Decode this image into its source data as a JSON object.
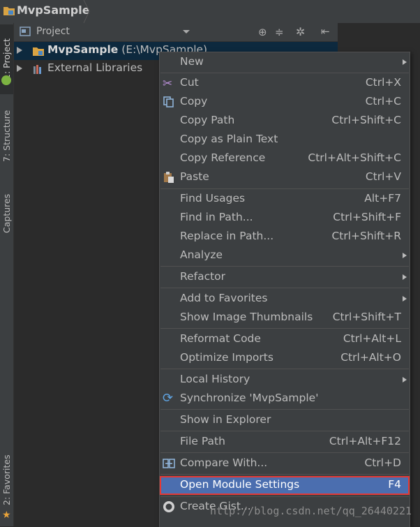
{
  "breadcrumb": {
    "title": "MvpSample"
  },
  "tool_strip": {
    "tabs": [
      {
        "label": "1: Project"
      },
      {
        "label": "7: Structure"
      },
      {
        "label": "Captures"
      },
      {
        "label": "2: Favorites"
      }
    ]
  },
  "project_panel": {
    "view_label": "Project",
    "tree": [
      {
        "name": "MvpSample",
        "path": "(E:\\MvpSample)"
      },
      {
        "name": "External Libraries"
      }
    ]
  },
  "context_menu": {
    "items": [
      {
        "label": "New",
        "shortcut": "",
        "submenu": true
      },
      {
        "label": "Cut",
        "shortcut": "Ctrl+X",
        "icon": "scissors-icon"
      },
      {
        "label": "Copy",
        "shortcut": "Ctrl+C",
        "icon": "copy-icon"
      },
      {
        "label": "Copy Path",
        "shortcut": "Ctrl+Shift+C"
      },
      {
        "label": "Copy as Plain Text",
        "shortcut": ""
      },
      {
        "label": "Copy Reference",
        "shortcut": "Ctrl+Alt+Shift+C"
      },
      {
        "label": "Paste",
        "shortcut": "Ctrl+V",
        "icon": "paste-icon"
      },
      {
        "label": "Find Usages",
        "shortcut": "Alt+F7"
      },
      {
        "label": "Find in Path...",
        "shortcut": "Ctrl+Shift+F"
      },
      {
        "label": "Replace in Path...",
        "shortcut": "Ctrl+Shift+R"
      },
      {
        "label": "Analyze",
        "shortcut": "",
        "submenu": true
      },
      {
        "label": "Refactor",
        "shortcut": "",
        "submenu": true
      },
      {
        "label": "Add to Favorites",
        "shortcut": "",
        "submenu": true
      },
      {
        "label": "Show Image Thumbnails",
        "shortcut": "Ctrl+Shift+T"
      },
      {
        "label": "Reformat Code",
        "shortcut": "Ctrl+Alt+L"
      },
      {
        "label": "Optimize Imports",
        "shortcut": "Ctrl+Alt+O"
      },
      {
        "label": "Local History",
        "shortcut": "",
        "submenu": true
      },
      {
        "label": "Synchronize 'MvpSample'",
        "shortcut": "",
        "icon": "sync-icon"
      },
      {
        "label": "Show in Explorer",
        "shortcut": ""
      },
      {
        "label": "File Path",
        "shortcut": "Ctrl+Alt+F12"
      },
      {
        "label": "Compare With...",
        "shortcut": "Ctrl+D",
        "icon": "compare-icon"
      },
      {
        "label": "Open Module Settings",
        "shortcut": "F4",
        "highlighted": true
      },
      {
        "label": "Create Gist...",
        "shortcut": "",
        "icon": "github-icon"
      }
    ]
  },
  "watermark": "http://blog.csdn.net/qq_26440221",
  "colors": {
    "background": "#2b2b2b",
    "panel": "#3c3f41",
    "selection": "#4b6eaf",
    "highlight_border": "#e53935"
  }
}
